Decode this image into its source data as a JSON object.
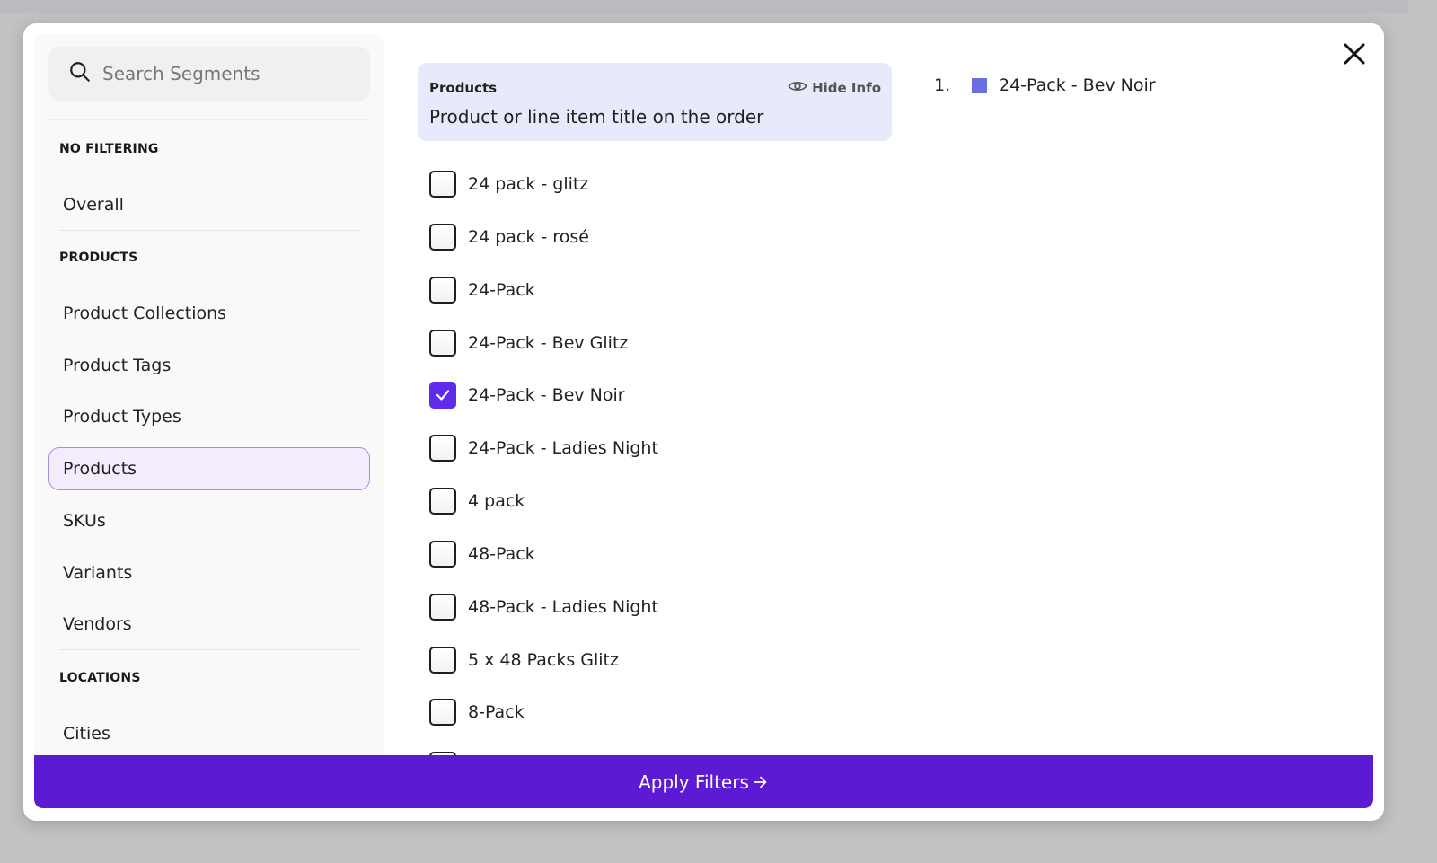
{
  "search": {
    "placeholder": "Search Segments",
    "value": ""
  },
  "sidebar": {
    "groups": [
      {
        "label": "NO FILTERING",
        "items": [
          {
            "label": "Overall"
          }
        ]
      },
      {
        "label": "PRODUCTS",
        "items": [
          {
            "label": "Product Collections"
          },
          {
            "label": "Product Tags"
          },
          {
            "label": "Product Types"
          },
          {
            "label": "Products",
            "active": true
          },
          {
            "label": "SKUs"
          },
          {
            "label": "Variants"
          },
          {
            "label": "Vendors"
          }
        ]
      },
      {
        "label": "LOCATIONS",
        "items": [
          {
            "label": "Cities"
          }
        ]
      }
    ]
  },
  "info": {
    "title": "Products",
    "description": "Product or line item title on the order",
    "hide_label": "Hide Info"
  },
  "options": [
    {
      "label": "24 pack - glitz",
      "checked": false
    },
    {
      "label": "24 pack - rosé",
      "checked": false
    },
    {
      "label": "24-Pack",
      "checked": false
    },
    {
      "label": "24-Pack - Bev Glitz",
      "checked": false
    },
    {
      "label": "24-Pack - Bev Noir",
      "checked": true
    },
    {
      "label": "24-Pack - Ladies Night",
      "checked": false
    },
    {
      "label": "4 pack",
      "checked": false
    },
    {
      "label": "48-Pack",
      "checked": false
    },
    {
      "label": "48-Pack - Ladies Night",
      "checked": false
    },
    {
      "label": "5 x 48 Packs Glitz",
      "checked": false
    },
    {
      "label": "8-Pack",
      "checked": false
    },
    {
      "label": "",
      "checked": false
    }
  ],
  "selected": [
    {
      "index": "1.",
      "label": "24-Pack - Bev Noir",
      "color": "#6a6fe0"
    }
  ],
  "apply_button": {
    "label": "Apply Filters"
  },
  "colors": {
    "accent": "#5c1bd2",
    "checkbox_checked": "#5e2cea",
    "info_bg": "#e8e9fb",
    "active_item_bg": "#f3ecfd",
    "active_item_border": "#a98ae6"
  }
}
